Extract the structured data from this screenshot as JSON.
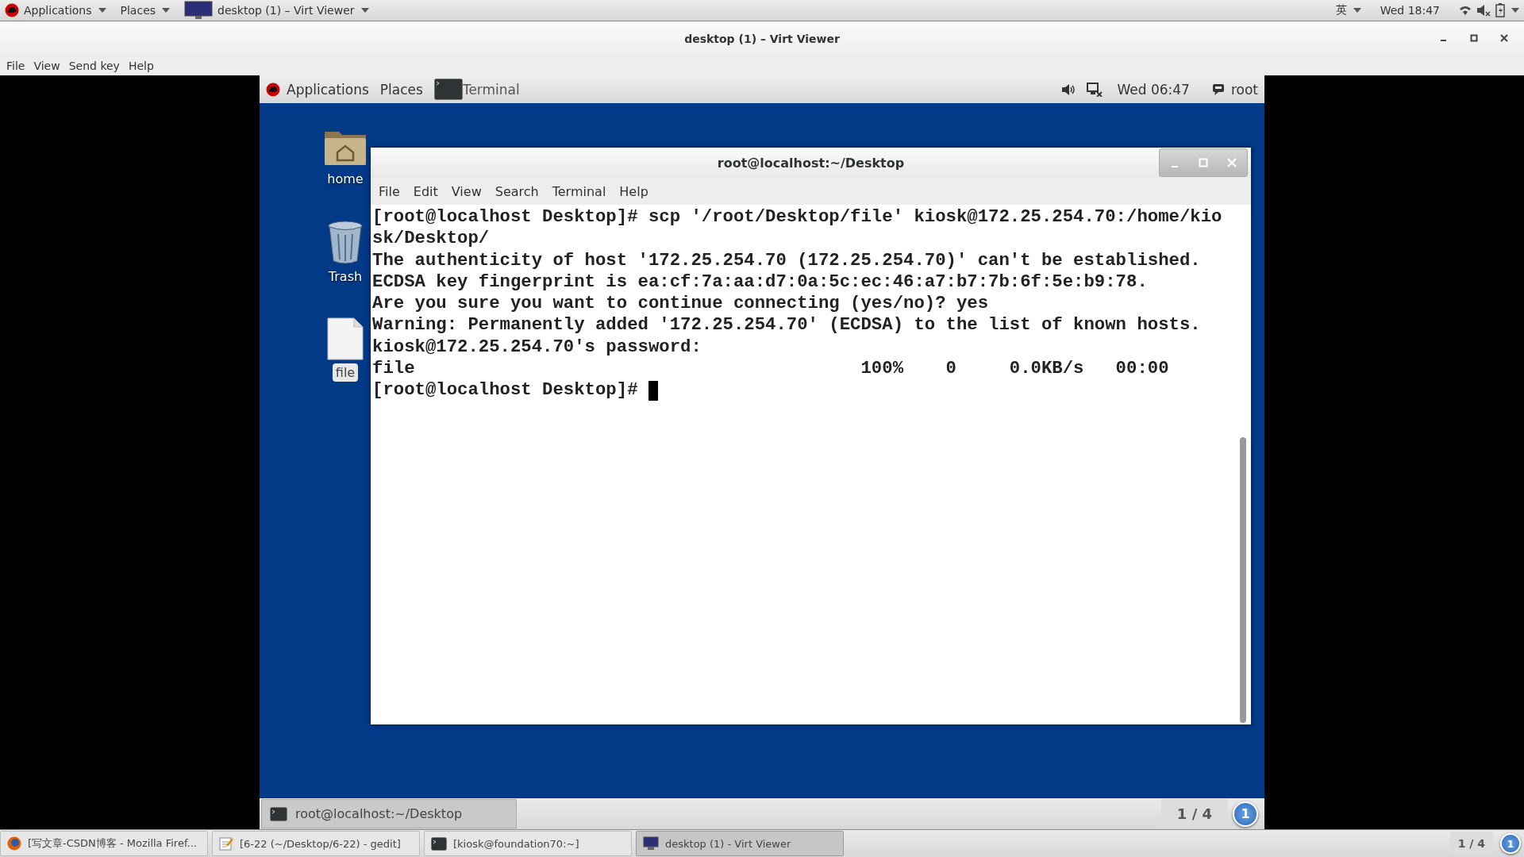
{
  "host_top_bar": {
    "menus": [
      {
        "label": "Applications"
      },
      {
        "label": "Places"
      }
    ],
    "window_button": "desktop (1) – Virt Viewer",
    "input_method": "英",
    "clock": "Wed 18:47"
  },
  "window": {
    "title": "desktop (1) – Virt Viewer",
    "menu": [
      "File",
      "View",
      "Send key",
      "Help"
    ]
  },
  "guest": {
    "top_bar": {
      "menus": [
        "Applications",
        "Places"
      ],
      "active_app": "Terminal",
      "clock": "Wed 06:47",
      "user": "root"
    },
    "desktop_icons": [
      {
        "label": "home",
        "kind": "folder",
        "selected": false
      },
      {
        "label": "Trash",
        "kind": "trash",
        "selected": false
      },
      {
        "label": "file",
        "kind": "document",
        "selected": true
      }
    ],
    "terminal": {
      "title": "root@localhost:~/Desktop",
      "menu": [
        "File",
        "Edit",
        "View",
        "Search",
        "Terminal",
        "Help"
      ],
      "lines": [
        "[root@localhost Desktop]# scp '/root/Desktop/file' kiosk@172.25.254.70:/home/kio",
        "sk/Desktop/",
        "The authenticity of host '172.25.254.70 (172.25.254.70)' can't be established.",
        "ECDSA key fingerprint is ea:cf:7a:aa:d7:0a:5c:ec:46:a7:b7:7b:6f:5e:b9:78.",
        "Are you sure you want to continue connecting (yes/no)? yes",
        "Warning: Permanently added '172.25.254.70' (ECDSA) to the list of known hosts.",
        "kiosk@172.25.254.70's password: ",
        "file                                          100%    0     0.0KB/s   00:00",
        "[root@localhost Desktop]# "
      ]
    },
    "bottom_panel": {
      "tasks": [
        {
          "label": "root@localhost:~/Desktop",
          "kind": "terminal",
          "selected": true
        }
      ],
      "workspace": "1 / 4",
      "badge": "1"
    }
  },
  "taskbar": {
    "tasks": [
      {
        "label": "[写文章-CSDN博客 - Mozilla Firef...",
        "kind": "browser",
        "selected": false
      },
      {
        "label": "[6-22 (~/Desktop/6-22) - gedit]",
        "kind": "editor",
        "selected": false
      },
      {
        "label": "[kiosk@foundation70:~]",
        "kind": "terminal",
        "selected": false
      },
      {
        "label": "desktop (1) - Virt Viewer",
        "kind": "display",
        "selected": true
      }
    ],
    "workspace": "1 / 4",
    "badge": "1"
  }
}
